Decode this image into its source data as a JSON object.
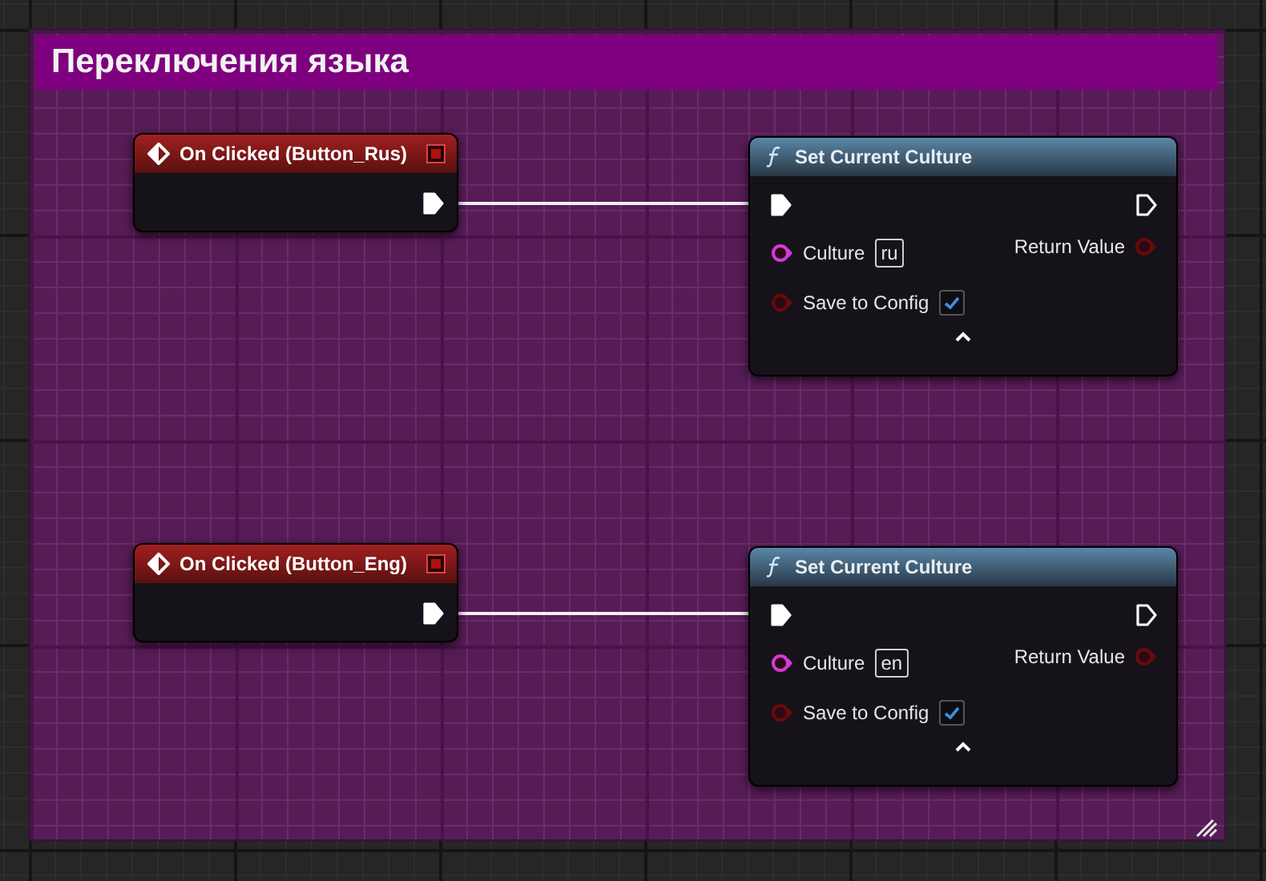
{
  "comment": {
    "title": "Переключения языка"
  },
  "rows": [
    {
      "event": {
        "title": "On Clicked (Button_Rus)"
      },
      "function": {
        "title": "Set Current Culture",
        "culture_label": "Culture",
        "culture_value": "ru",
        "save_label": "Save to Config",
        "save_checked": true,
        "return_label": "Return Value"
      }
    },
    {
      "event": {
        "title": "On Clicked (Button_Eng)"
      },
      "function": {
        "title": "Set Current Culture",
        "culture_label": "Culture",
        "culture_value": "en",
        "save_label": "Save to Config",
        "save_checked": true,
        "return_label": "Return Value"
      }
    }
  ]
}
